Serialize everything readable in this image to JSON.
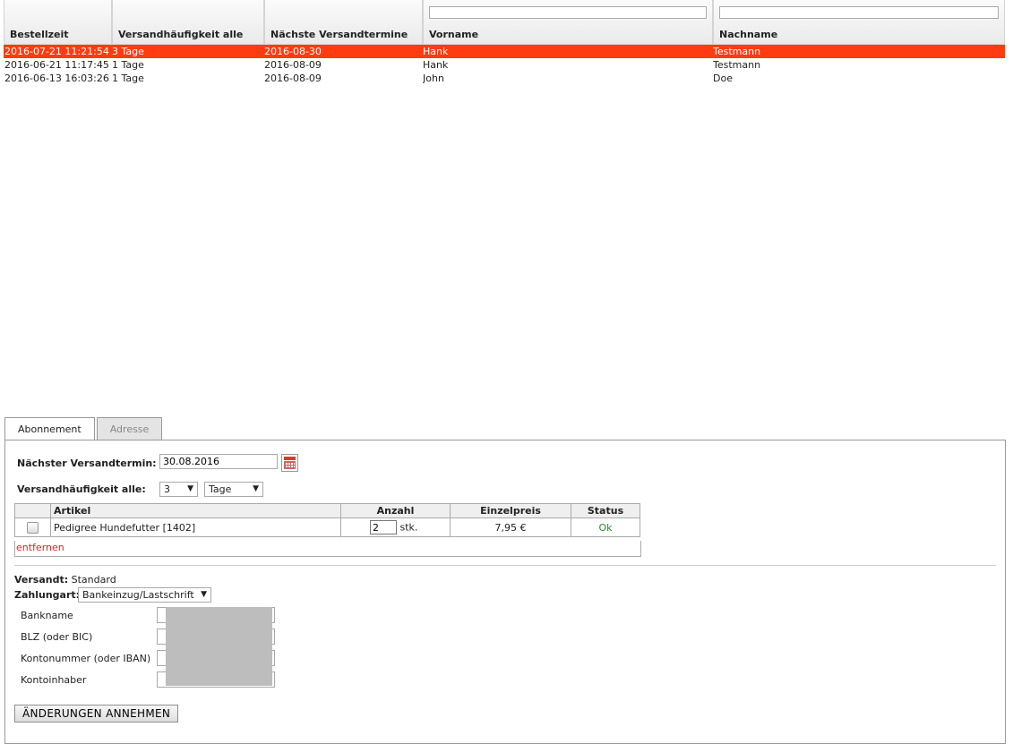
{
  "grid": {
    "columns": [
      "Bestellzeit",
      "Versandhäufigkeit alle",
      "Nächste Versandtermine",
      "Vorname",
      "Nachname"
    ],
    "filter_vorname": "",
    "filter_nachname": "",
    "rows": [
      {
        "bestellzeit": "2016-07-21 11:21:54",
        "haeufigkeit": "3 Tage",
        "naechste": "2016-08-30",
        "vorname": "Hank",
        "nachname": "Testmann",
        "selected": true
      },
      {
        "bestellzeit": "2016-06-21 11:17:45",
        "haeufigkeit": "1 Tage",
        "naechste": "2016-08-09",
        "vorname": "Hank",
        "nachname": "Testmann",
        "selected": false
      },
      {
        "bestellzeit": "2016-06-13 16:03:26",
        "haeufigkeit": "1 Tage",
        "naechste": "2016-08-09",
        "vorname": "John",
        "nachname": "Doe",
        "selected": false
      }
    ],
    "selected_color": "#ff3b10"
  },
  "tabs": [
    "Abonnement",
    "Adresse"
  ],
  "form": {
    "next_date_label": "Nächster Versandtermin:",
    "next_date_value": "30.08.2016",
    "freq_label": "Versandhäufigkeit alle:",
    "freq_value": "3",
    "freq_unit": "Tage",
    "table_headers": [
      "Artikel",
      "Anzahl",
      "Einzelpreis",
      "Status"
    ],
    "item": {
      "artikel": "Pedigree Hundefutter [1402]",
      "anzahl": "2",
      "unit": "stk.",
      "preis": "7,95 €",
      "status": "Ok"
    },
    "remove_label": "entfernen",
    "versandt_label": "Versandt:",
    "versandt_value": "Standard",
    "zahlung_label": "Zahlungart:",
    "zahlung_value": "Bankeinzug/Lastschrift",
    "bank_fields": [
      "Bankname",
      "BLZ (oder BIC)",
      "Kontonummer (oder IBAN)",
      "Kontoinhaber"
    ],
    "submit_label": "ÄNDERUNGEN ANNEHMEN"
  },
  "icons": {
    "dropdown": "▼",
    "calendar": "calendar-icon"
  }
}
